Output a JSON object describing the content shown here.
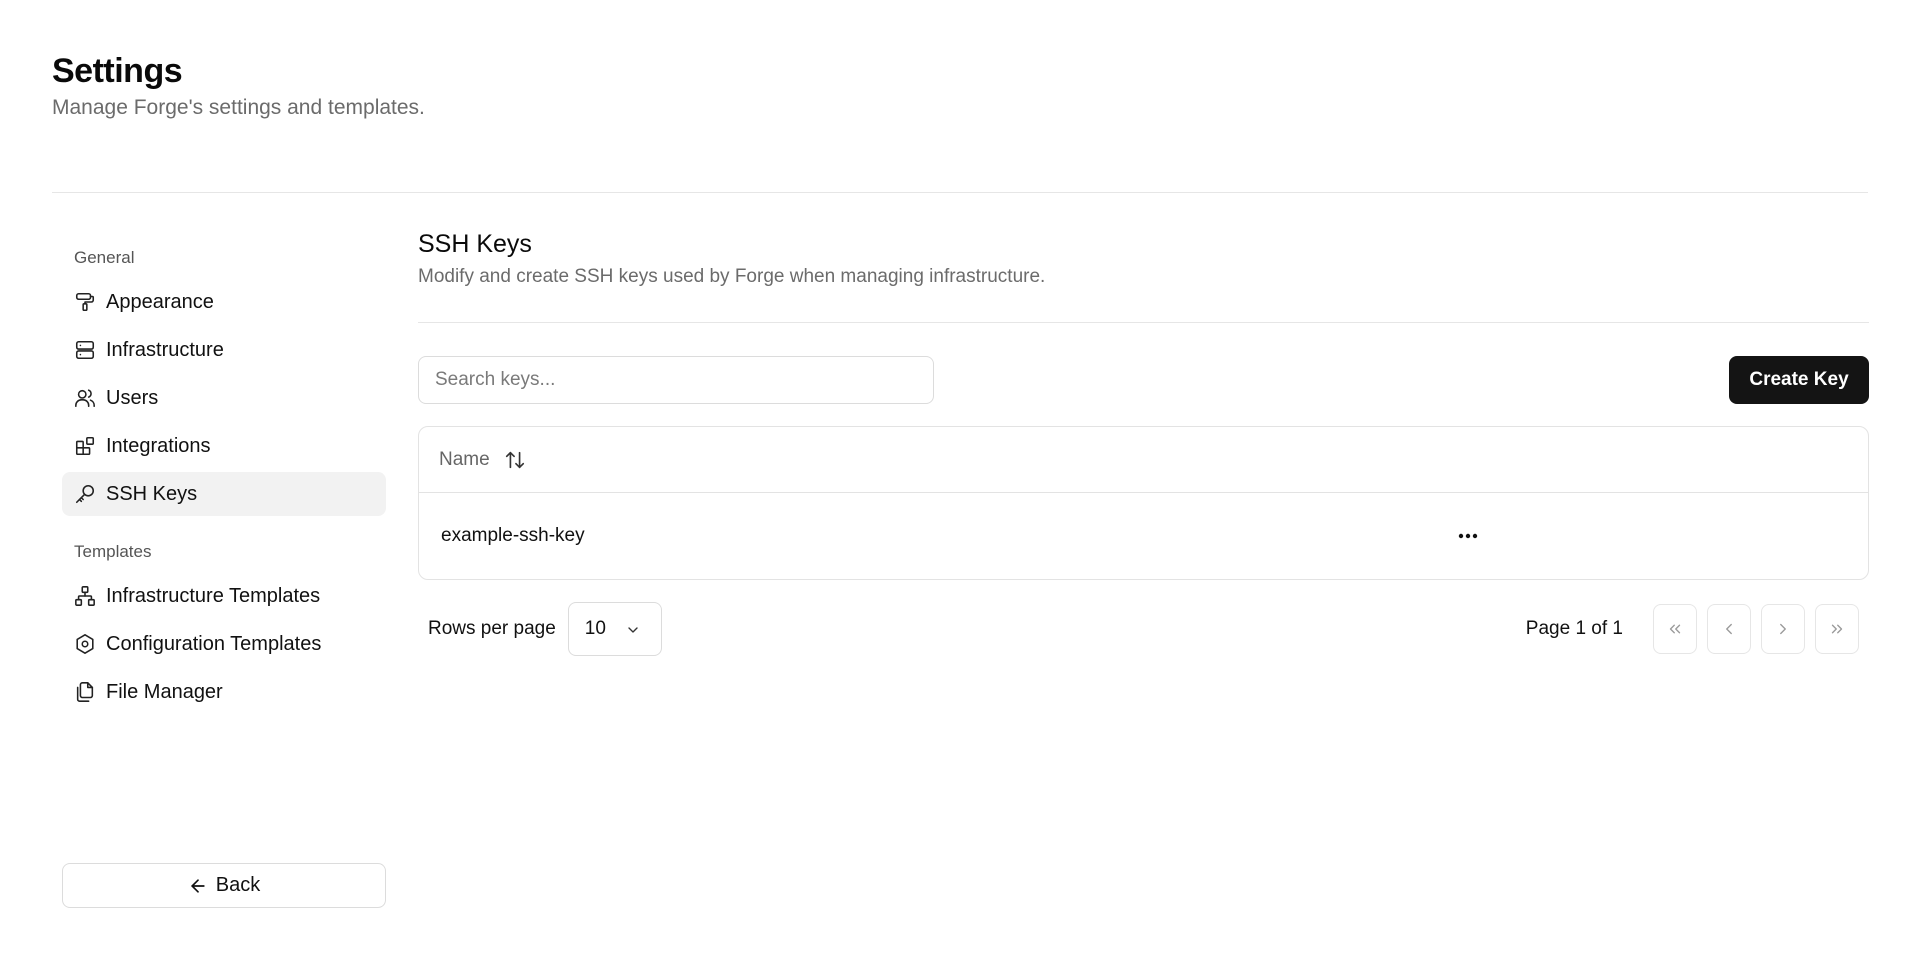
{
  "page": {
    "title": "Settings",
    "subtitle": "Manage Forge's settings and templates."
  },
  "sidebar": {
    "groups": [
      {
        "label": "General",
        "items": [
          {
            "label": "Appearance",
            "icon": "paint-roller-icon"
          },
          {
            "label": "Infrastructure",
            "icon": "server-icon"
          },
          {
            "label": "Users",
            "icon": "users-icon"
          },
          {
            "label": "Integrations",
            "icon": "blocks-icon"
          },
          {
            "label": "SSH Keys",
            "icon": "key-icon",
            "active": true
          }
        ]
      },
      {
        "label": "Templates",
        "items": [
          {
            "label": "Infrastructure Templates",
            "icon": "network-icon"
          },
          {
            "label": "Configuration Templates",
            "icon": "hexagon-settings-icon"
          },
          {
            "label": "File Manager",
            "icon": "files-icon"
          }
        ]
      }
    ],
    "back_label": "Back"
  },
  "main": {
    "title": "SSH Keys",
    "subtitle": "Modify and create SSH keys used by Forge when managing infrastructure.",
    "search": {
      "placeholder": "Search keys...",
      "value": ""
    },
    "create_label": "Create Key",
    "table": {
      "columns": [
        "Name"
      ],
      "rows": [
        {
          "name": "example-ssh-key"
        }
      ]
    },
    "pagination": {
      "rows_label": "Rows per page",
      "rows_value": "10",
      "page_info": "Page 1 of 1"
    }
  },
  "colors": {
    "primary_button": "#141414",
    "active_nav_bg": "#f2f2f2",
    "muted_text": "#6b6b6b",
    "border": "#e3e3e3"
  }
}
